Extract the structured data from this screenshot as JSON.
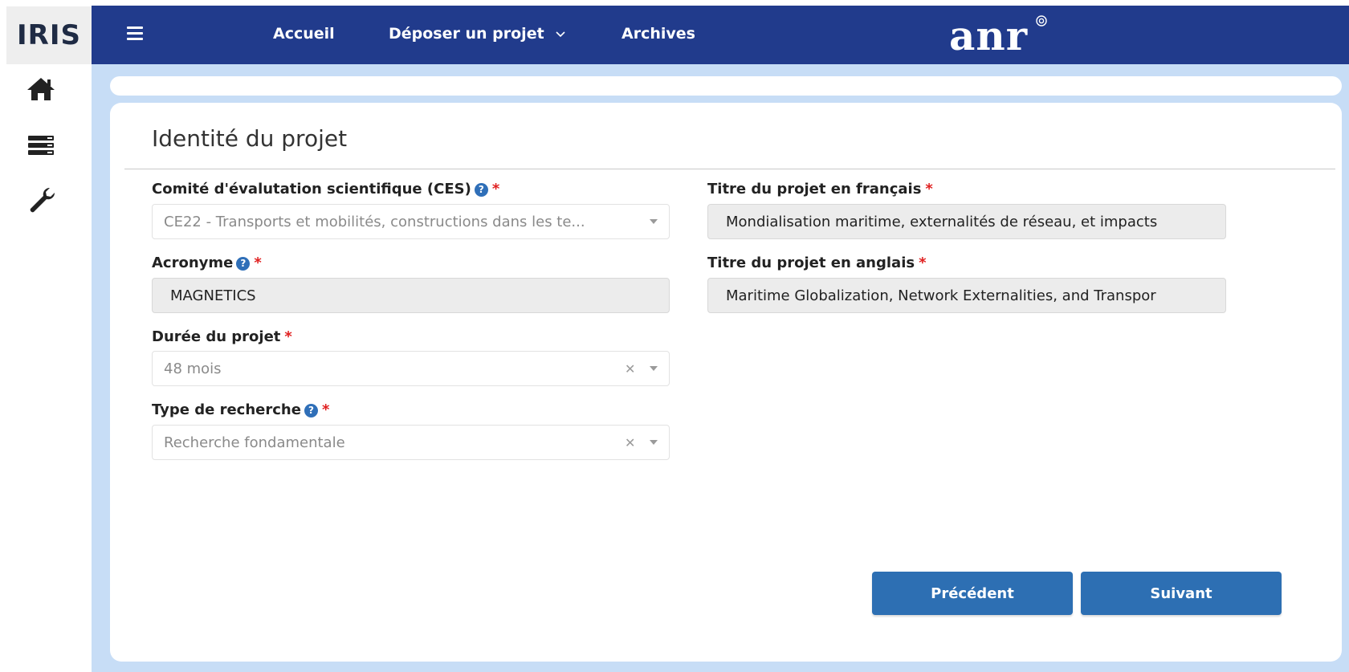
{
  "app": {
    "rail_logo": "IRIS",
    "brand": "anr"
  },
  "rail": {
    "icons": [
      "home-icon",
      "list-icon",
      "wrench-icon"
    ]
  },
  "nav": {
    "accueil": "Accueil",
    "deposer": "Déposer un projet",
    "archives": "Archives"
  },
  "panel": {
    "title": "Identité du projet"
  },
  "form": {
    "ces": {
      "label": "Comité d'évalutation scientifique (CES)",
      "value": "CE22 - Transports et mobilités, constructions dans les te..."
    },
    "acronyme": {
      "label": "Acronyme",
      "value": "MAGNETICS"
    },
    "duree": {
      "label": "Durée du projet",
      "value": "48 mois"
    },
    "type": {
      "label": "Type de recherche",
      "value": "Recherche fondamentale"
    },
    "titre_fr": {
      "label": "Titre du projet en français",
      "value": "Mondialisation maritime, externalités de réseau, et impacts"
    },
    "titre_en": {
      "label": "Titre du projet en anglais",
      "value": "Maritime Globalization, Network Externalities, and Transpor"
    },
    "required_mark": "*",
    "help_mark": "?"
  },
  "buttons": {
    "precedent": "Précédent",
    "suivant": "Suivant"
  },
  "colors": {
    "topbar": "#213b8c",
    "content_bg": "#c7ddf6",
    "button": "#2d6fb3",
    "required": "#e02020"
  }
}
